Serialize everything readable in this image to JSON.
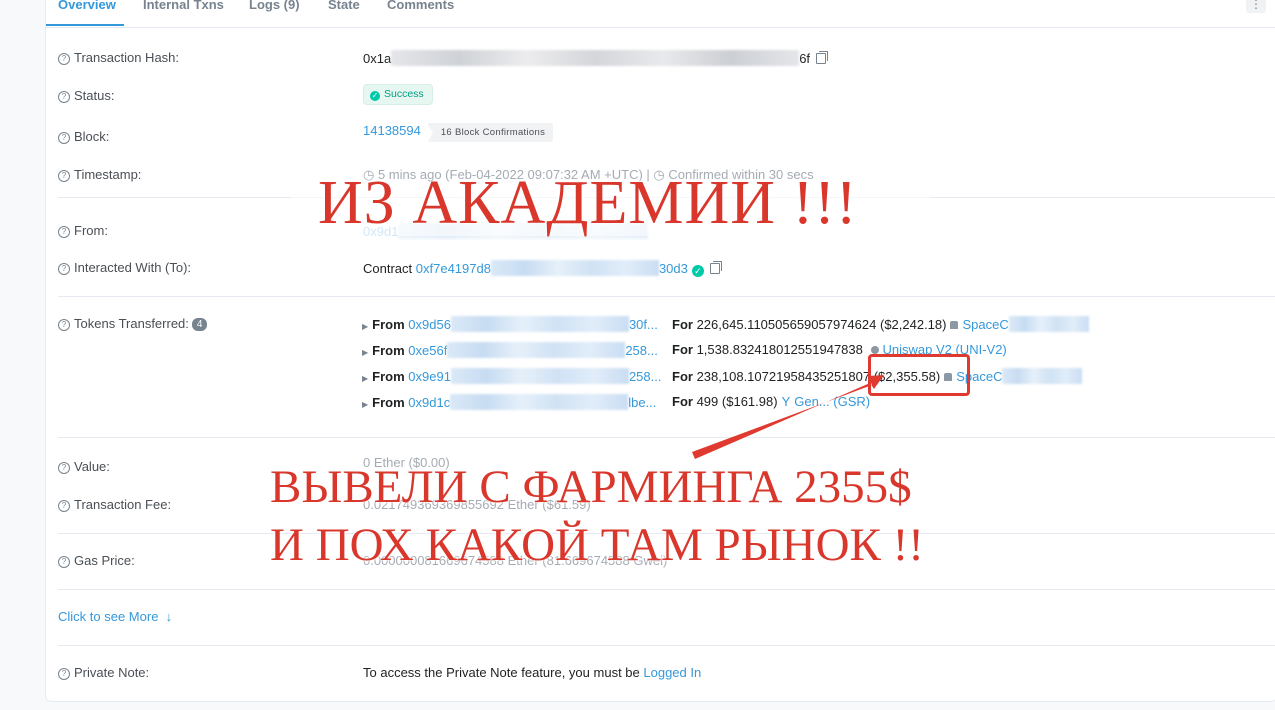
{
  "tabs": [
    {
      "label": "Overview",
      "active": true
    },
    {
      "label": "Internal Txns"
    },
    {
      "label": "Logs (9)"
    },
    {
      "label": "State"
    },
    {
      "label": "Comments"
    }
  ],
  "kebab": "⋮",
  "rows": {
    "hash": {
      "label": "Transaction Hash:",
      "prefix": "0x1a",
      "suffix": "6f"
    },
    "status": {
      "label": "Status:",
      "value": "Success"
    },
    "block": {
      "label": "Block:",
      "number": "14138594",
      "confirmations": "16 Block Confirmations"
    },
    "timestamp": {
      "label": "Timestamp:",
      "value": "5 mins ago (Feb-04-2022 09:07:32 AM +UTC)",
      "confirmed": "Confirmed within 30 secs"
    },
    "from": {
      "label": "From:",
      "prefix": "0x9d1"
    },
    "interacted": {
      "label": "Interacted With (To):",
      "contract_label": "Contract",
      "prefix": "0xf7e4197d8",
      "suffix": "30d3"
    },
    "tokens": {
      "label": "Tokens Transferred:",
      "count": "4"
    },
    "value": {
      "label": "Value:",
      "value": "0 Ether ($0.00)"
    },
    "fee": {
      "label": "Transaction Fee:",
      "value": "0.021749369369855692 Ether ($61.59)"
    },
    "gas": {
      "label": "Gas Price:",
      "value": "0.000000081669674588 Ether (81.669674588 Gwei)"
    },
    "more": {
      "label": "Click to see More",
      "arrow": "↓"
    },
    "note": {
      "label": "Private Note:",
      "text": "To access the Private Note feature, you must be",
      "link": "Logged In"
    }
  },
  "transfers": [
    {
      "from_label": "From",
      "from": "0x9d56",
      "to_tail": "30f...",
      "for_label": "For",
      "amount": "226,645.110505659057974624",
      "usd": "($2,242.18)",
      "token": "SpaceC"
    },
    {
      "from_label": "From",
      "from": "0xe56f",
      "to_tail": "258...",
      "for_label": "For",
      "amount": "1,538.832418012551947838",
      "usd": "",
      "token": "Uniswap V2 (UNI-V2)"
    },
    {
      "from_label": "From",
      "from": "0x9e91",
      "to_tail": "258...",
      "for_label": "For",
      "amount": "238,108.10721958435251807",
      "usd": "($2,355.58)",
      "token": "SpaceC"
    },
    {
      "from_label": "From",
      "from": "0x9d1c",
      "to_tail": "lbe...",
      "for_label": "For",
      "amount": "499",
      "usd": "($161.98)",
      "token": "Gen... (GSR)"
    }
  ],
  "overlay": {
    "top": "ИЗ АКАДЕМИИ !!!",
    "line1": "ВЫВЕЛИ С ФАРМИНГА 2355$",
    "line2": "И ПОХ КАКОЙ ТАМ РЫНОК !!"
  },
  "colors": {
    "accent": "#3498db",
    "annotation": "#d9362c",
    "success": "#00c9a7"
  }
}
